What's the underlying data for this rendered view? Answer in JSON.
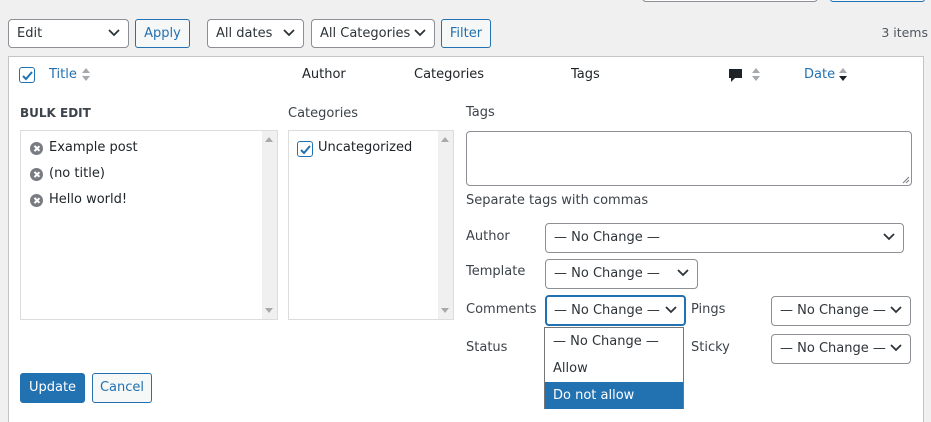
{
  "top_bar": {
    "bulk_action": "Edit",
    "apply_label": "Apply",
    "date_filter": "All dates",
    "category_filter": "All Categories",
    "filter_label": "Filter",
    "items_count": "3 items"
  },
  "table_header": {
    "title": "Title",
    "author": "Author",
    "categories": "Categories",
    "tags": "Tags",
    "date": "Date"
  },
  "bulk_edit": {
    "heading": "BULK EDIT",
    "posts": [
      "Example post",
      "(no title)",
      "Hello world!"
    ],
    "categories_label": "Categories",
    "categories": [
      {
        "name": "Uncategorized",
        "checked": true
      }
    ],
    "tags_label": "Tags",
    "tags_value": "",
    "tags_hint": "Separate tags with commas",
    "author_label": "Author",
    "author_value": "— No Change —",
    "template_label": "Template",
    "template_value": "— No Change —",
    "comments_label": "Comments",
    "comments_value": "— No Change —",
    "comments_options": [
      "— No Change —",
      "Allow",
      "Do not allow"
    ],
    "comments_highlighted": "Do not allow",
    "pings_label": "Pings",
    "pings_value": "— No Change —",
    "status_label": "Status",
    "sticky_label": "Sticky",
    "sticky_value": "— No Change —",
    "update_label": "Update",
    "cancel_label": "Cancel"
  },
  "colors": {
    "accent": "#2271b1",
    "background": "#f0f0f1",
    "border": "#c3c4c7"
  }
}
